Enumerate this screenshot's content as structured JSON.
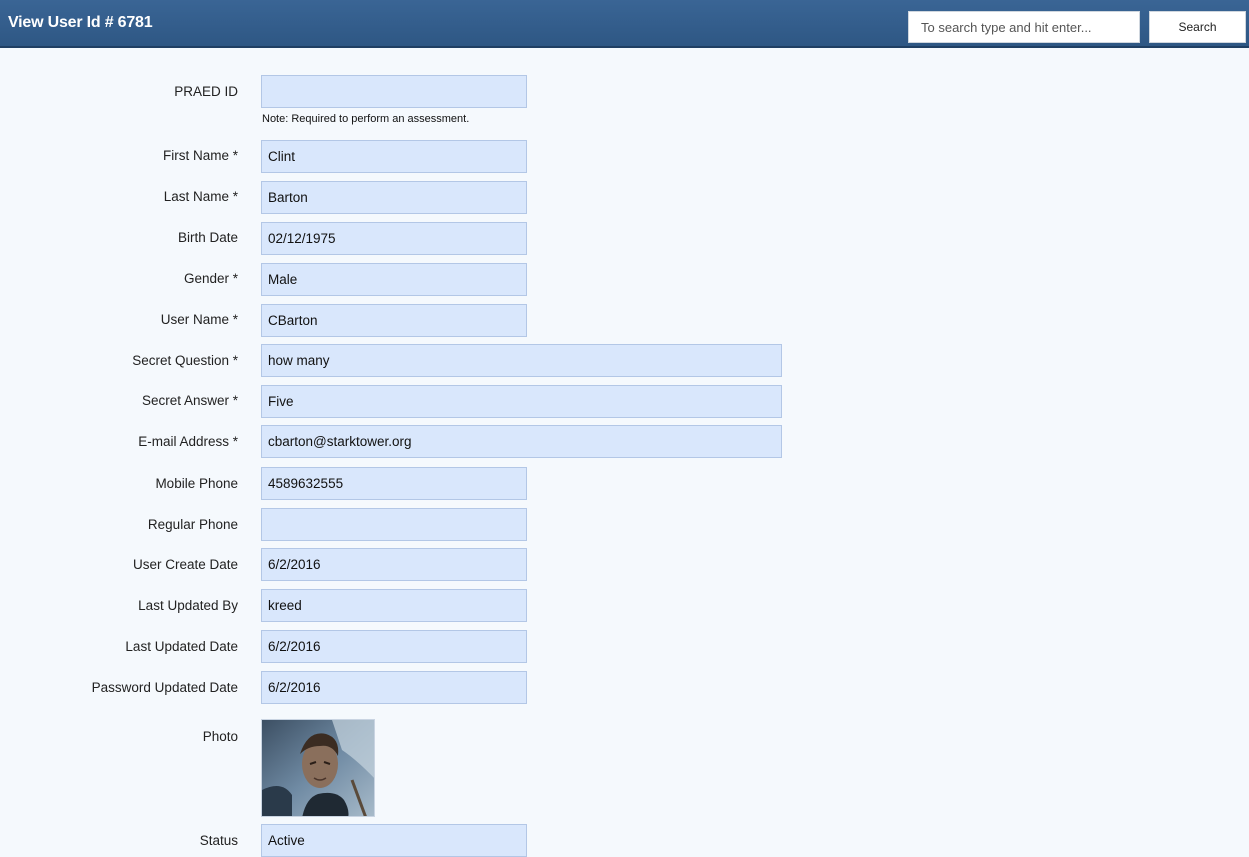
{
  "header": {
    "title": "View User Id # 6781",
    "search_placeholder": "To search type and hit enter...",
    "search_button": "Search"
  },
  "form": {
    "praed_note": "Note: Required to perform an assessment.",
    "photo_label": "Photo",
    "fields": [
      {
        "label": "PRAED ID",
        "value": ""
      },
      {
        "label": "First Name *",
        "value": "Clint"
      },
      {
        "label": "Last Name *",
        "value": "Barton"
      },
      {
        "label": "Birth Date",
        "value": "02/12/1975"
      },
      {
        "label": "Gender *",
        "value": "Male"
      },
      {
        "label": "User Name *",
        "value": "CBarton"
      },
      {
        "label": "Secret Question *",
        "value": "how many"
      },
      {
        "label": "Secret Answer *",
        "value": "Five"
      },
      {
        "label": "E-mail Address *",
        "value": "cbarton@starktower.org"
      },
      {
        "label": "Mobile Phone",
        "value": "4589632555"
      },
      {
        "label": "Regular Phone",
        "value": ""
      },
      {
        "label": "User Create Date",
        "value": "6/2/2016"
      },
      {
        "label": "Last Updated By",
        "value": "kreed"
      },
      {
        "label": "Last Updated Date",
        "value": "6/2/2016"
      },
      {
        "label": "Password Updated Date",
        "value": "6/2/2016"
      },
      {
        "label": "Status",
        "value": "Active"
      }
    ]
  },
  "colors": {
    "header_bg": "#3a6595",
    "field_bg": "#d9e7fc",
    "page_bg": "#f5f9fd"
  }
}
